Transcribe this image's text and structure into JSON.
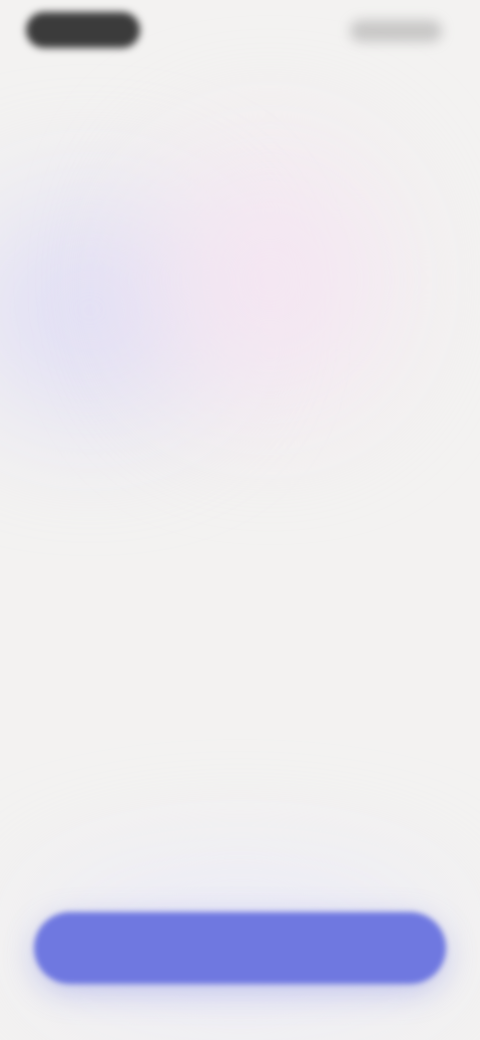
{
  "status_bar": {
    "left_pill": "",
    "right_indicators": ""
  },
  "hero": {
    "headline": ""
  },
  "footer": {
    "cta_label": ""
  },
  "colors": {
    "background": "#f3f2f1",
    "accent": "#6f78e0",
    "headline_text": "#4a4a4a",
    "glow_violet": "#dedcf6",
    "glow_pink": "#f5e4f2"
  }
}
